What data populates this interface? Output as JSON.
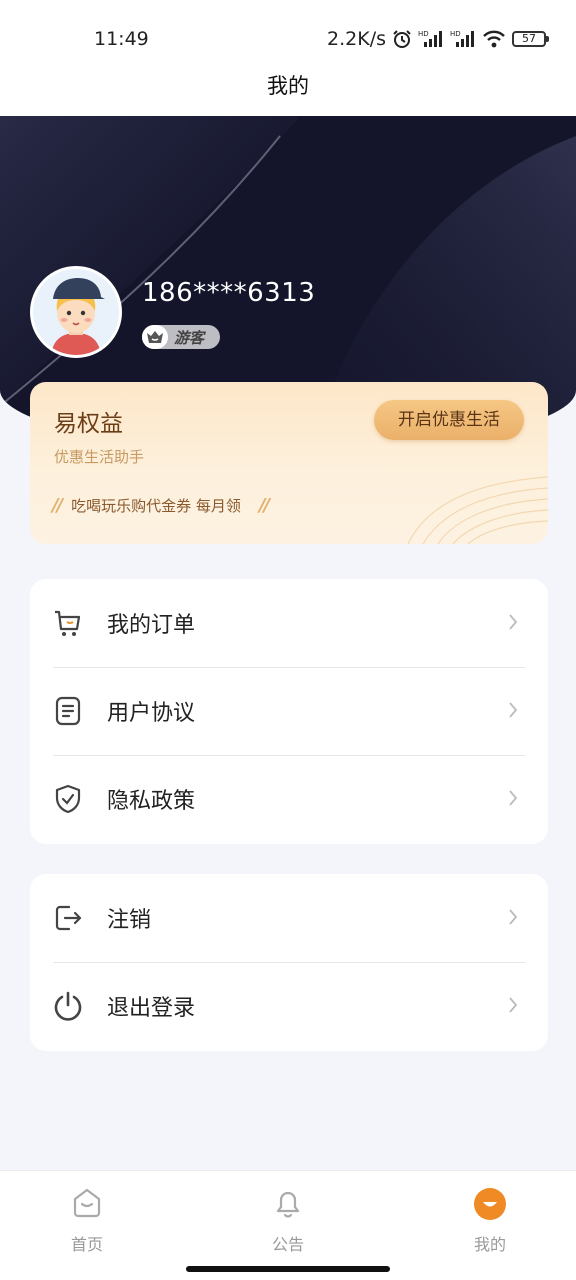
{
  "status_bar": {
    "time": "11:49",
    "net_speed": "2.2K/s",
    "battery": "57",
    "icons": [
      "alarm-icon",
      "hd-signal-icon",
      "hd-signal-icon",
      "wifi-icon",
      "battery-icon"
    ]
  },
  "nav": {
    "title": "我的"
  },
  "profile": {
    "phone": "186****6313",
    "badge": "游客",
    "avatar_icon": "user-avatar-icon"
  },
  "benefit": {
    "title": "易权益",
    "subtitle": "优惠生活助手",
    "button": "开启优惠生活",
    "slogan": "吃喝玩乐购代金券 每月领",
    "accent": "#eab06a"
  },
  "menu_main": [
    {
      "label": "我的订单",
      "icon": "cart-icon"
    },
    {
      "label": "用户协议",
      "icon": "document-icon"
    },
    {
      "label": "隐私政策",
      "icon": "shield-check-icon"
    }
  ],
  "menu_account": [
    {
      "label": "注销",
      "icon": "logout-icon"
    },
    {
      "label": "退出登录",
      "icon": "power-icon"
    }
  ],
  "tabs": [
    {
      "label": "首页",
      "icon": "home-face-icon"
    },
    {
      "label": "公告",
      "icon": "bell-icon"
    },
    {
      "label": "我的",
      "icon": "profile-face-icon",
      "active": true
    }
  ],
  "colors": {
    "hero_bg": "#14152b",
    "active_tab": "#f08a24"
  }
}
